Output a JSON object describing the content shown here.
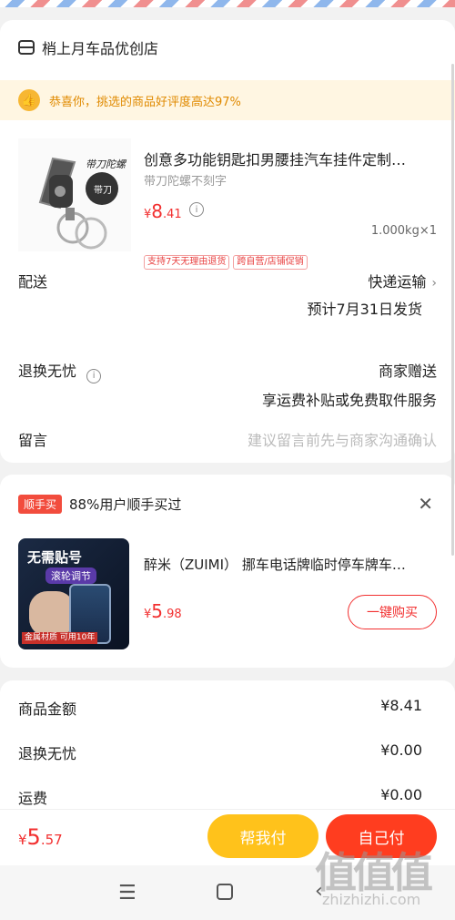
{
  "order": {
    "shop_name": "梢上月车品优创店",
    "banner_text": "恭喜你，挑选的商品好评度高达97%",
    "product": {
      "title": "创意多功能钥匙扣男腰挂汽车挂件定制…",
      "spec": "带刀陀螺不刻字",
      "price_symbol": "¥",
      "price_int": "8",
      "price_dec": ".41",
      "qty": "1.000kg×1",
      "tags": [
        "支持7天无理由退货",
        "跨自营/店铺促销"
      ],
      "image_label": "带刀陀螺",
      "image_badge": "带刀"
    },
    "delivery_label": "配送",
    "delivery_method": "快递运输",
    "delivery_eta": "预计7月31日发货",
    "returns_label": "退换无忧",
    "returns_value": "商家赠送",
    "returns_desc": "享运费补贴或免费取件服务",
    "message_label": "留言",
    "message_placeholder": "建议留言前先与商家沟通确认"
  },
  "addon": {
    "badge": "顺手买",
    "headline": "88%用户顺手买过",
    "title": "醉米（ZUIMI） 挪车电话牌临时停车牌车…",
    "price_symbol": "¥",
    "price_int": "5",
    "price_dec": ".98",
    "buy_label": "一键购买",
    "image_big": "无需贴号",
    "image_sub": "滚轮调节",
    "image_corner": "金属材质 可用10年"
  },
  "summary": {
    "rows": [
      {
        "label": "商品金额",
        "value": "¥8.41"
      },
      {
        "label": "退换无忧",
        "value": "¥0.00"
      },
      {
        "label": "运费",
        "value": "¥0.00"
      }
    ]
  },
  "bottom": {
    "total_symbol": "¥",
    "total_int": "5",
    "total_dec": ".57",
    "help_pay": "帮我付",
    "self_pay": "自己付"
  },
  "watermark": {
    "main": "值值值",
    "sub": "zhizhizhi.com"
  },
  "colors": {
    "accent": "#f23030",
    "help_button": "#ffc21b",
    "self_button": "#ff3d1f",
    "banner_bg": "#fff6e2"
  }
}
